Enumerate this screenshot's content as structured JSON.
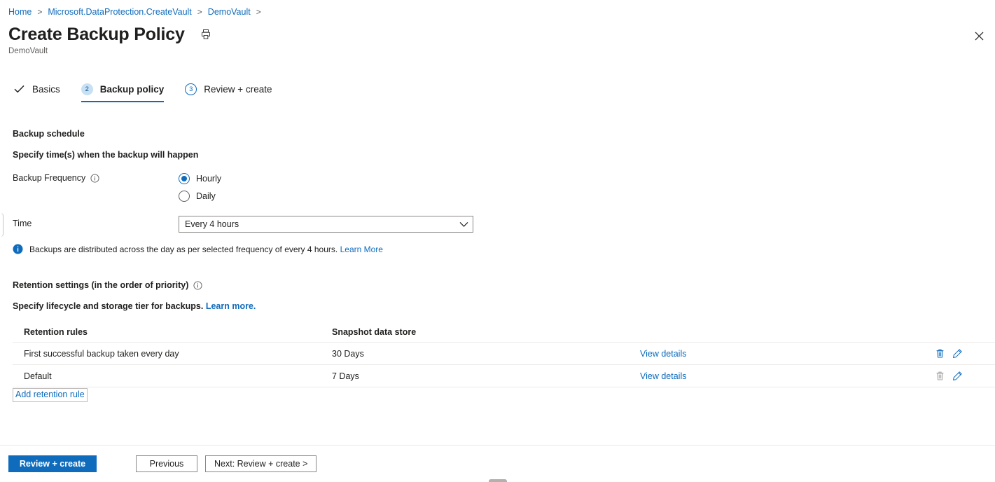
{
  "breadcrumb": {
    "items": [
      {
        "label": "Home"
      },
      {
        "label": "Microsoft.DataProtection.CreateVault"
      },
      {
        "label": "DemoVault"
      }
    ],
    "separator": ">"
  },
  "header": {
    "title": "Create Backup Policy",
    "subtitle": "DemoVault",
    "print_icon": "printer-icon",
    "close_icon": "close-icon"
  },
  "wizard": {
    "tabs": [
      {
        "label": "Basics",
        "marker": "check",
        "marker_text": "✓",
        "state": "completed"
      },
      {
        "label": "Backup policy",
        "marker": "number",
        "marker_text": "2",
        "state": "active"
      },
      {
        "label": "Review + create",
        "marker": "number",
        "marker_text": "3",
        "state": "upcoming"
      }
    ]
  },
  "schedule": {
    "section_title": "Backup schedule",
    "instruction": "Specify time(s) when the backup will happen",
    "frequency_label": "Backup Frequency",
    "frequency_info_icon": "info-circle-icon",
    "frequency_options": [
      {
        "label": "Hourly",
        "selected": true
      },
      {
        "label": "Daily",
        "selected": false
      }
    ],
    "time_label": "Time",
    "time_value": "Every 4 hours",
    "time_chevron_icon": "chevron-down-icon",
    "info_icon": "info-filled-icon",
    "info_text": "Backups are distributed across the day as per selected frequency of every 4 hours.",
    "info_link": "Learn More"
  },
  "retention": {
    "section_title": "Retention settings (in the order of priority)",
    "section_info_icon": "info-circle-icon",
    "description": "Specify lifecycle and storage tier for backups.",
    "description_link": "Learn more.",
    "columns": [
      "Retention rules",
      "Snapshot data store"
    ],
    "rows": [
      {
        "rule": "First successful backup taken every day",
        "store": "30 Days",
        "view_link": "View details",
        "delete_icon": "trash-icon",
        "delete_enabled": true,
        "edit_icon": "pencil-icon",
        "edit_enabled": true
      },
      {
        "rule": "Default",
        "store": "7 Days",
        "view_link": "View details",
        "delete_icon": "trash-icon",
        "delete_enabled": false,
        "edit_icon": "pencil-icon",
        "edit_enabled": true
      }
    ],
    "add_link": "Add retention rule"
  },
  "footer": {
    "review_create": "Review + create",
    "previous": "Previous",
    "next": "Next: Review + create >"
  },
  "colors": {
    "accent": "#0f6cbd",
    "link": "#0f6cbd",
    "text": "#201f1e",
    "muted": "#605e5c",
    "border": "#edebe9",
    "badge_fill": "#c7e0f4",
    "disabled_icon": "#a19f9d"
  }
}
